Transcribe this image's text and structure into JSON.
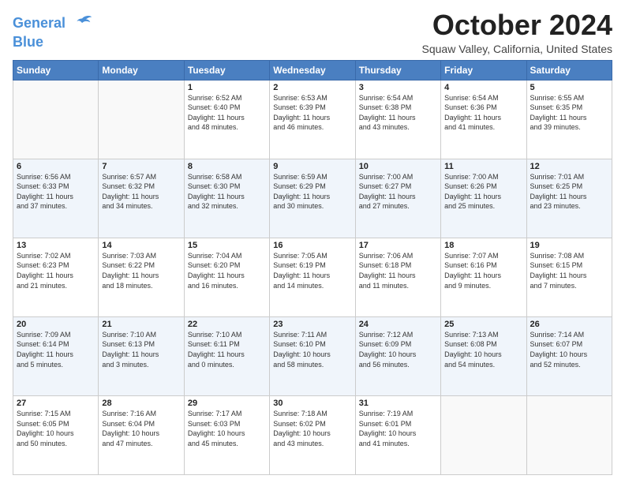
{
  "header": {
    "logo_line1": "General",
    "logo_line2": "Blue",
    "month": "October 2024",
    "location": "Squaw Valley, California, United States"
  },
  "weekdays": [
    "Sunday",
    "Monday",
    "Tuesday",
    "Wednesday",
    "Thursday",
    "Friday",
    "Saturday"
  ],
  "weeks": [
    [
      {
        "day": "",
        "info": ""
      },
      {
        "day": "",
        "info": ""
      },
      {
        "day": "1",
        "info": "Sunrise: 6:52 AM\nSunset: 6:40 PM\nDaylight: 11 hours\nand 48 minutes."
      },
      {
        "day": "2",
        "info": "Sunrise: 6:53 AM\nSunset: 6:39 PM\nDaylight: 11 hours\nand 46 minutes."
      },
      {
        "day": "3",
        "info": "Sunrise: 6:54 AM\nSunset: 6:38 PM\nDaylight: 11 hours\nand 43 minutes."
      },
      {
        "day": "4",
        "info": "Sunrise: 6:54 AM\nSunset: 6:36 PM\nDaylight: 11 hours\nand 41 minutes."
      },
      {
        "day": "5",
        "info": "Sunrise: 6:55 AM\nSunset: 6:35 PM\nDaylight: 11 hours\nand 39 minutes."
      }
    ],
    [
      {
        "day": "6",
        "info": "Sunrise: 6:56 AM\nSunset: 6:33 PM\nDaylight: 11 hours\nand 37 minutes."
      },
      {
        "day": "7",
        "info": "Sunrise: 6:57 AM\nSunset: 6:32 PM\nDaylight: 11 hours\nand 34 minutes."
      },
      {
        "day": "8",
        "info": "Sunrise: 6:58 AM\nSunset: 6:30 PM\nDaylight: 11 hours\nand 32 minutes."
      },
      {
        "day": "9",
        "info": "Sunrise: 6:59 AM\nSunset: 6:29 PM\nDaylight: 11 hours\nand 30 minutes."
      },
      {
        "day": "10",
        "info": "Sunrise: 7:00 AM\nSunset: 6:27 PM\nDaylight: 11 hours\nand 27 minutes."
      },
      {
        "day": "11",
        "info": "Sunrise: 7:00 AM\nSunset: 6:26 PM\nDaylight: 11 hours\nand 25 minutes."
      },
      {
        "day": "12",
        "info": "Sunrise: 7:01 AM\nSunset: 6:25 PM\nDaylight: 11 hours\nand 23 minutes."
      }
    ],
    [
      {
        "day": "13",
        "info": "Sunrise: 7:02 AM\nSunset: 6:23 PM\nDaylight: 11 hours\nand 21 minutes."
      },
      {
        "day": "14",
        "info": "Sunrise: 7:03 AM\nSunset: 6:22 PM\nDaylight: 11 hours\nand 18 minutes."
      },
      {
        "day": "15",
        "info": "Sunrise: 7:04 AM\nSunset: 6:20 PM\nDaylight: 11 hours\nand 16 minutes."
      },
      {
        "day": "16",
        "info": "Sunrise: 7:05 AM\nSunset: 6:19 PM\nDaylight: 11 hours\nand 14 minutes."
      },
      {
        "day": "17",
        "info": "Sunrise: 7:06 AM\nSunset: 6:18 PM\nDaylight: 11 hours\nand 11 minutes."
      },
      {
        "day": "18",
        "info": "Sunrise: 7:07 AM\nSunset: 6:16 PM\nDaylight: 11 hours\nand 9 minutes."
      },
      {
        "day": "19",
        "info": "Sunrise: 7:08 AM\nSunset: 6:15 PM\nDaylight: 11 hours\nand 7 minutes."
      }
    ],
    [
      {
        "day": "20",
        "info": "Sunrise: 7:09 AM\nSunset: 6:14 PM\nDaylight: 11 hours\nand 5 minutes."
      },
      {
        "day": "21",
        "info": "Sunrise: 7:10 AM\nSunset: 6:13 PM\nDaylight: 11 hours\nand 3 minutes."
      },
      {
        "day": "22",
        "info": "Sunrise: 7:10 AM\nSunset: 6:11 PM\nDaylight: 11 hours\nand 0 minutes."
      },
      {
        "day": "23",
        "info": "Sunrise: 7:11 AM\nSunset: 6:10 PM\nDaylight: 10 hours\nand 58 minutes."
      },
      {
        "day": "24",
        "info": "Sunrise: 7:12 AM\nSunset: 6:09 PM\nDaylight: 10 hours\nand 56 minutes."
      },
      {
        "day": "25",
        "info": "Sunrise: 7:13 AM\nSunset: 6:08 PM\nDaylight: 10 hours\nand 54 minutes."
      },
      {
        "day": "26",
        "info": "Sunrise: 7:14 AM\nSunset: 6:07 PM\nDaylight: 10 hours\nand 52 minutes."
      }
    ],
    [
      {
        "day": "27",
        "info": "Sunrise: 7:15 AM\nSunset: 6:05 PM\nDaylight: 10 hours\nand 50 minutes."
      },
      {
        "day": "28",
        "info": "Sunrise: 7:16 AM\nSunset: 6:04 PM\nDaylight: 10 hours\nand 47 minutes."
      },
      {
        "day": "29",
        "info": "Sunrise: 7:17 AM\nSunset: 6:03 PM\nDaylight: 10 hours\nand 45 minutes."
      },
      {
        "day": "30",
        "info": "Sunrise: 7:18 AM\nSunset: 6:02 PM\nDaylight: 10 hours\nand 43 minutes."
      },
      {
        "day": "31",
        "info": "Sunrise: 7:19 AM\nSunset: 6:01 PM\nDaylight: 10 hours\nand 41 minutes."
      },
      {
        "day": "",
        "info": ""
      },
      {
        "day": "",
        "info": ""
      }
    ]
  ]
}
